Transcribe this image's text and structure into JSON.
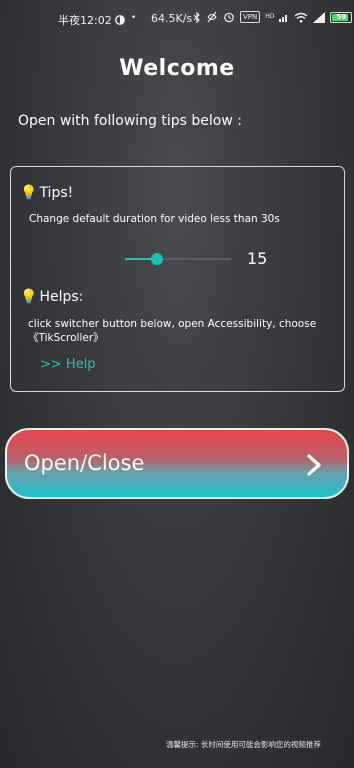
{
  "status_bar": {
    "time": "半夜12:02",
    "network_speed": "64.5K/s",
    "vpn": "VPN",
    "hd": "HD",
    "battery": "59"
  },
  "page": {
    "title": "Welcome",
    "subtitle": "Open with following tips below :"
  },
  "tips": {
    "heading": "Tips!",
    "description": "Change default duration for video less than 30s",
    "slider_value": "15",
    "slider_fraction": 0.3
  },
  "helps": {
    "heading": "Helps:",
    "description": "click switcher button below, open Accessibility, choose 《TikScroller》",
    "link": ">>  Help"
  },
  "main_button": {
    "label": "Open/Close"
  },
  "footer": {
    "tip": "温馨提示: 长时间使用可能会影响您的视频推荐"
  },
  "colors": {
    "accent": "#1ec6b5",
    "button_top": "#e8454d",
    "button_bottom": "#1cc3cf"
  }
}
